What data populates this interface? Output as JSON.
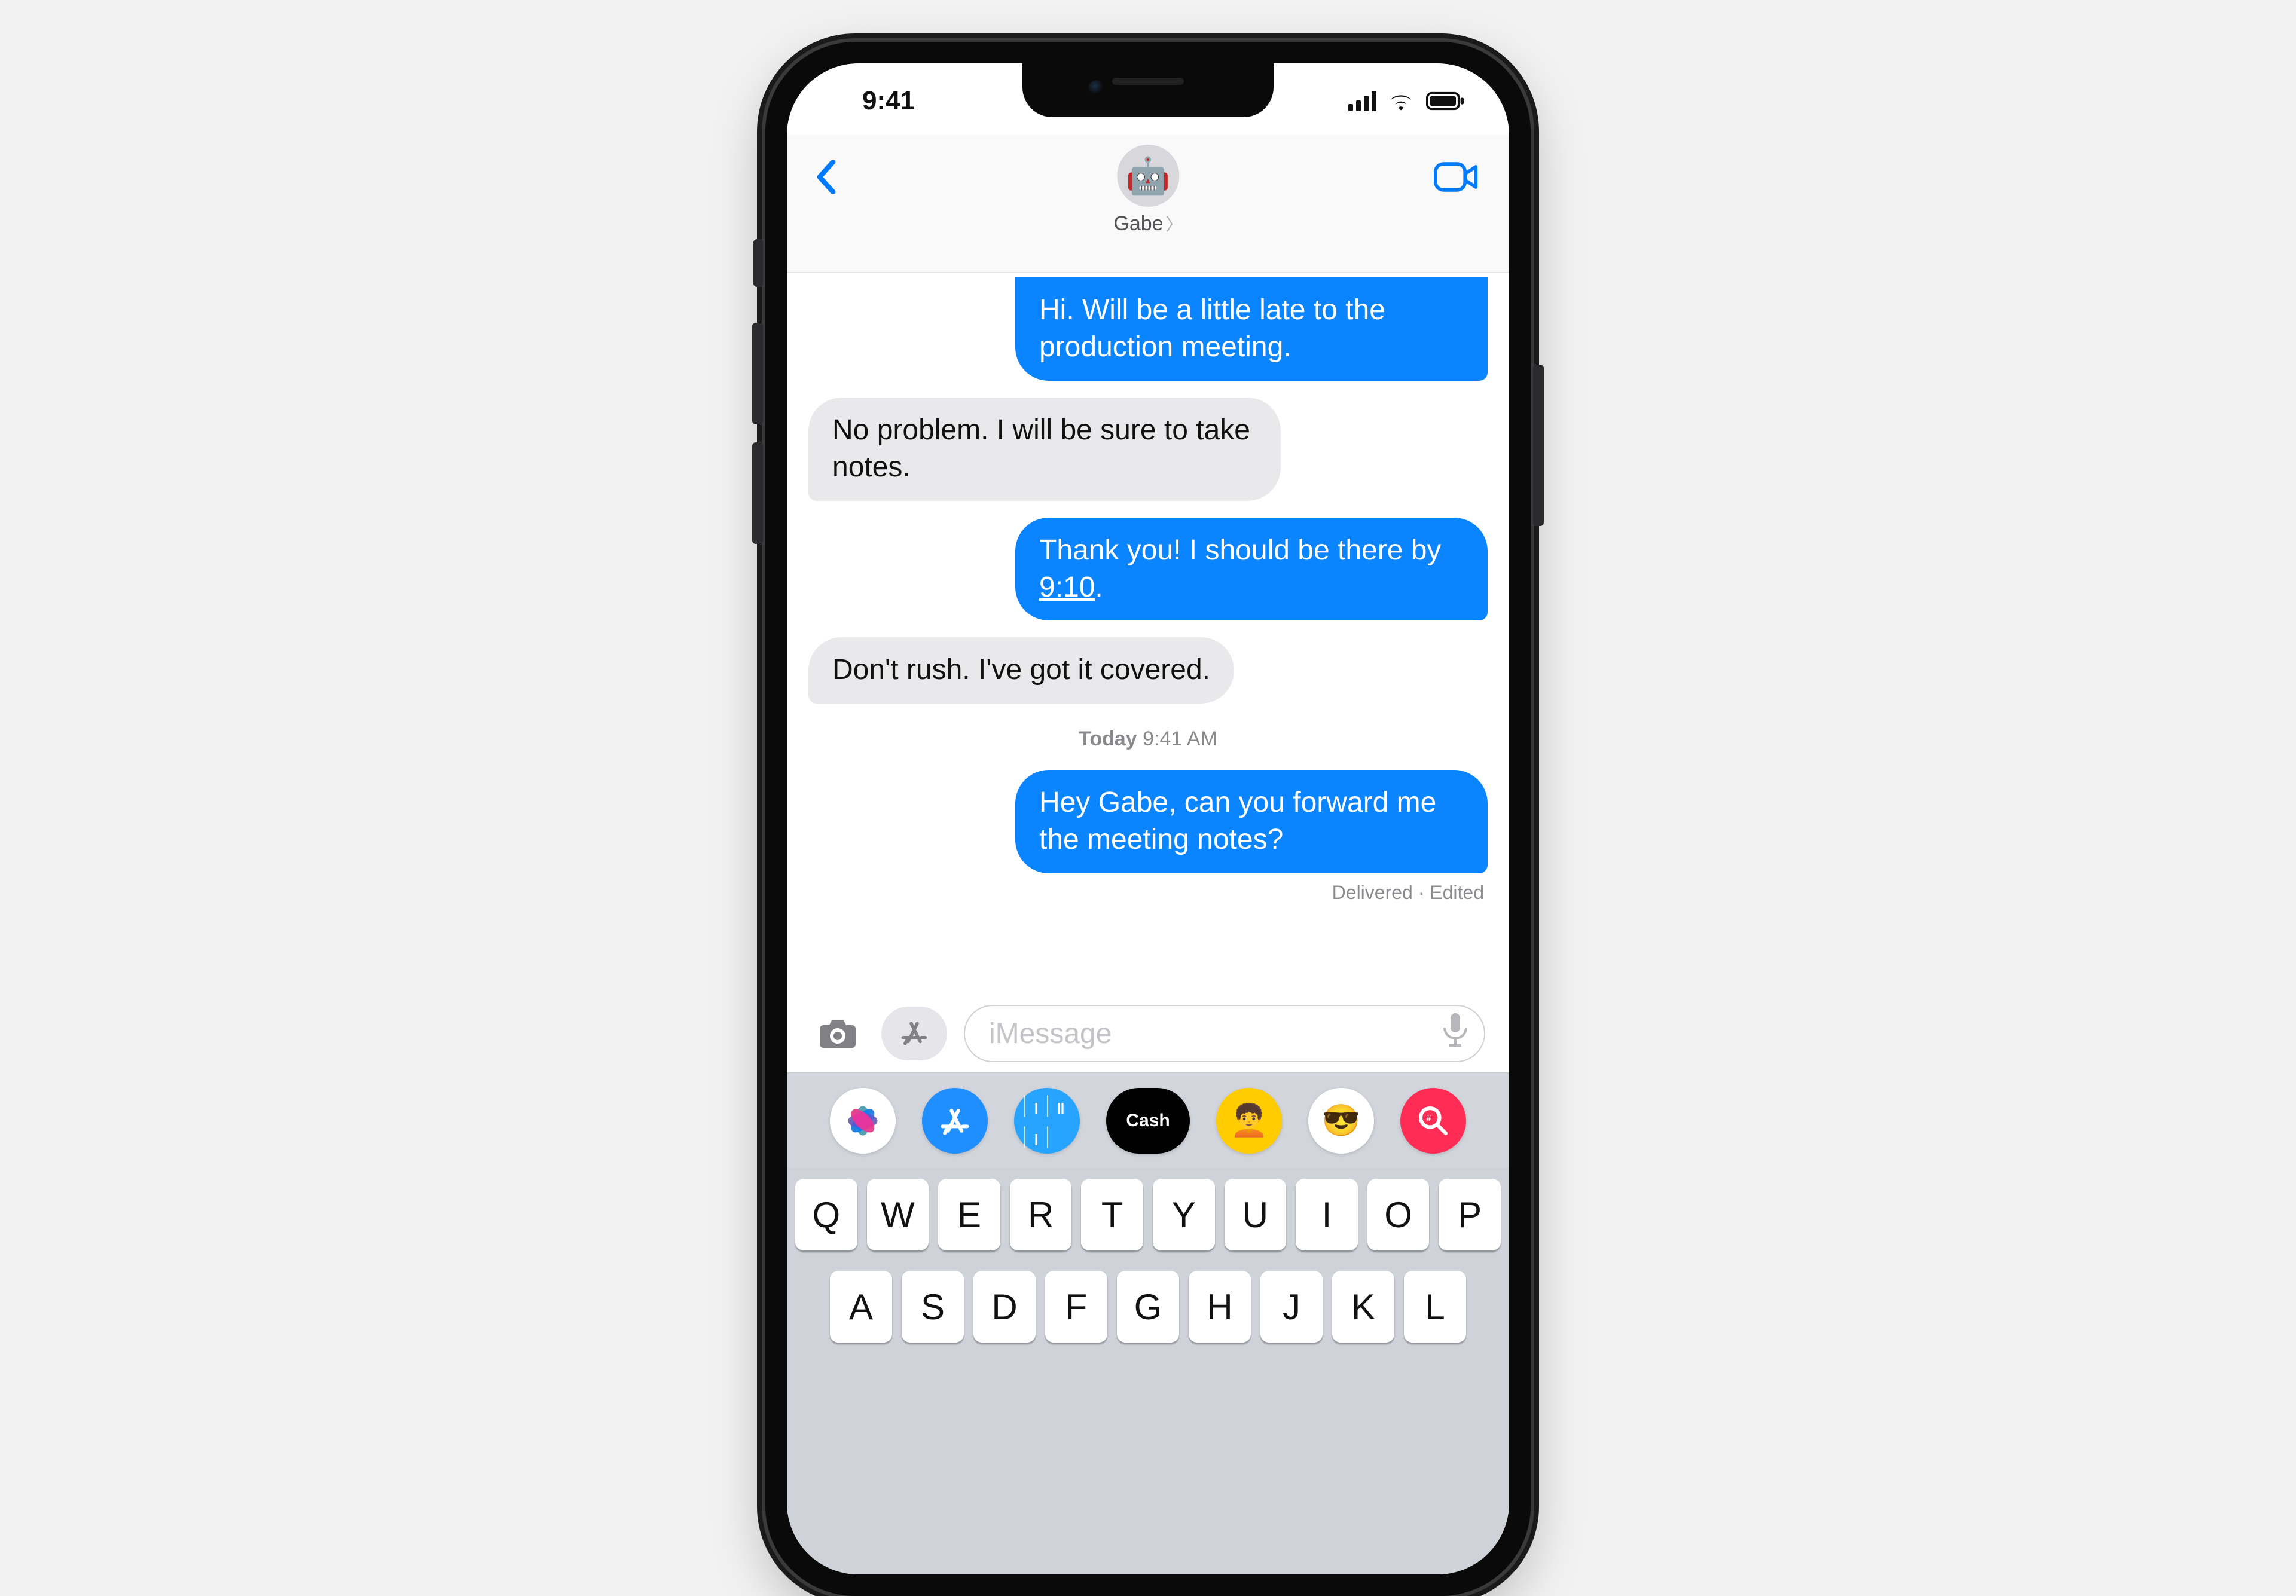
{
  "status": {
    "time": "9:41"
  },
  "header": {
    "contact_name": "Gabe",
    "avatar_emoji": "🤖"
  },
  "messages": {
    "m0": "Hi. Will be a little late to the production meeting.",
    "m1": "No problem. I will be sure to take notes.",
    "m2_pre": "Thank you! I should be there by ",
    "m2_time": "9:10",
    "m2_post": ".",
    "m3": "Don't rush. I've got it covered.",
    "divider_label": "Today",
    "divider_time": "9:41 AM",
    "m4": "Hey Gabe, can you forward me the meeting notes?",
    "status_line": "Delivered · Edited"
  },
  "compose": {
    "placeholder": "iMessage"
  },
  "drawer": {
    "cash_label": "Cash"
  },
  "keyboard": {
    "row1": [
      "Q",
      "W",
      "E",
      "R",
      "T",
      "Y",
      "U",
      "I",
      "O",
      "P"
    ],
    "row2": [
      "A",
      "S",
      "D",
      "F",
      "G",
      "H",
      "J",
      "K",
      "L"
    ]
  }
}
